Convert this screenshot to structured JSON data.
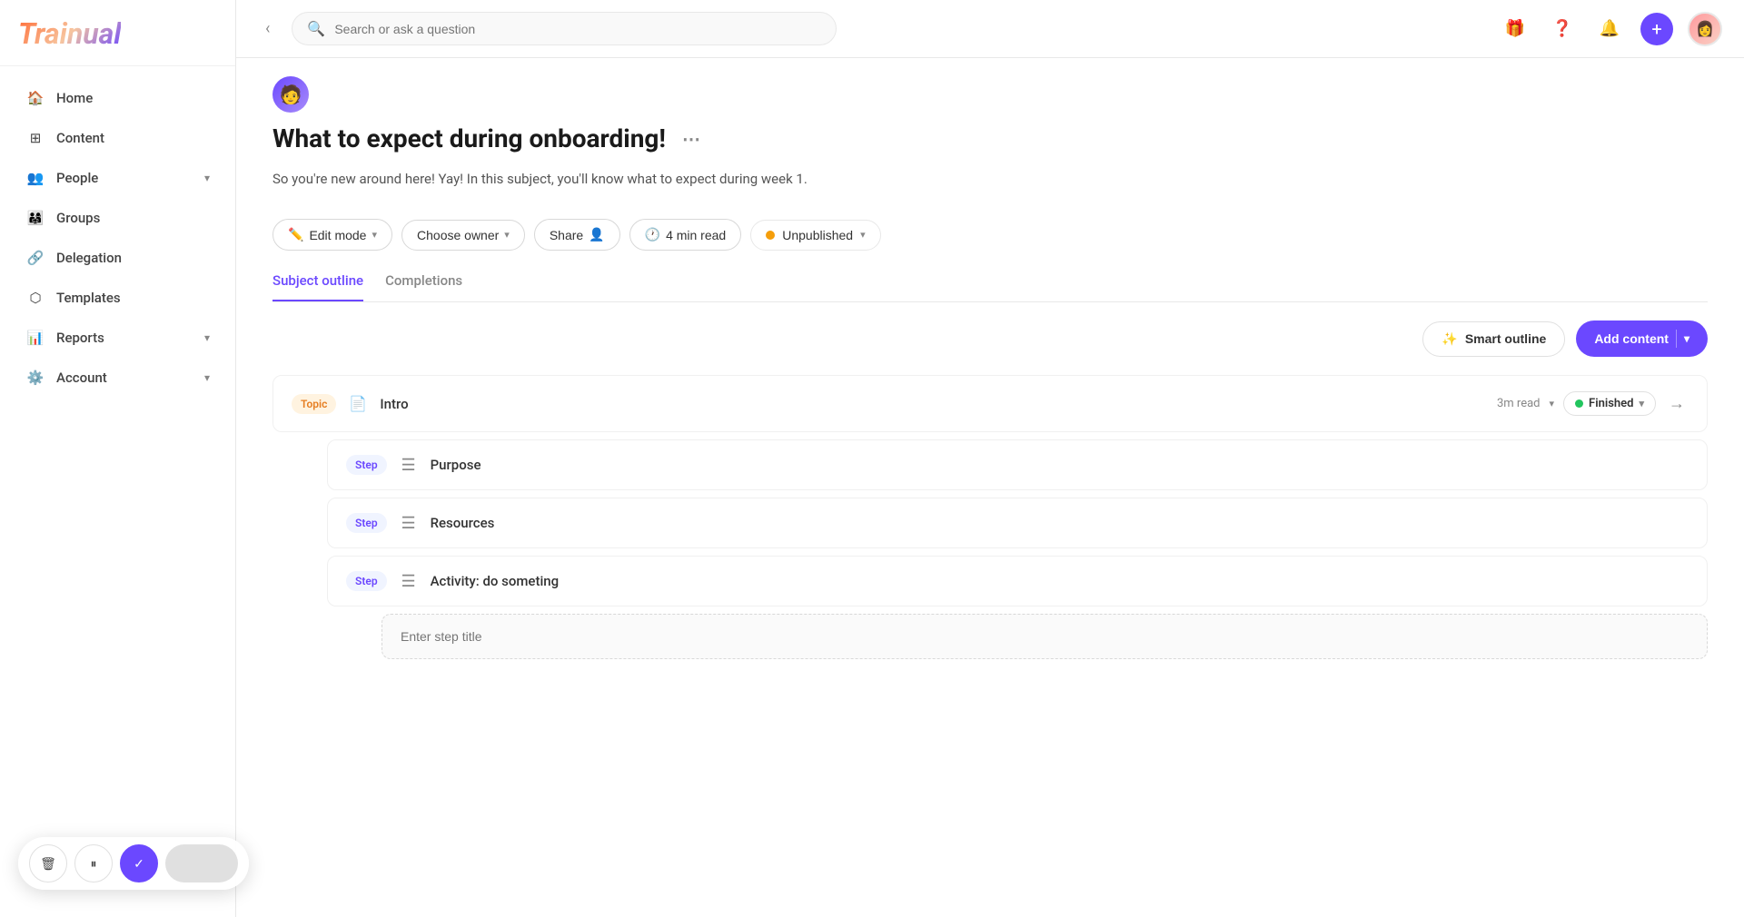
{
  "logo": {
    "text": "Trainual"
  },
  "sidebar": {
    "nav_items": [
      {
        "id": "home",
        "label": "Home",
        "icon": "🏠",
        "has_chevron": false
      },
      {
        "id": "content",
        "label": "Content",
        "icon": "⊞",
        "has_chevron": false
      },
      {
        "id": "people",
        "label": "People",
        "icon": "👥",
        "has_chevron": true
      },
      {
        "id": "groups",
        "label": "Groups",
        "icon": "👨‍👩‍👧",
        "has_chevron": false
      },
      {
        "id": "delegation",
        "label": "Delegation",
        "icon": "🔗",
        "has_chevron": false
      },
      {
        "id": "templates",
        "label": "Templates",
        "icon": "⬡",
        "has_chevron": false
      },
      {
        "id": "reports",
        "label": "Reports",
        "icon": "📊",
        "has_chevron": true
      },
      {
        "id": "account",
        "label": "Account",
        "icon": "⚙️",
        "has_chevron": true
      }
    ]
  },
  "topbar": {
    "search_placeholder": "Search or ask a question",
    "collapse_label": "‹"
  },
  "page": {
    "title": "What to expect during onboarding!",
    "description": "So you're new around here! Yay! In this subject, you'll know what to expect during week 1.",
    "read_time": "4 min read"
  },
  "toolbar": {
    "edit_mode_label": "Edit mode",
    "choose_owner_label": "Choose owner",
    "share_label": "Share",
    "status_label": "Unpublished"
  },
  "tabs": [
    {
      "id": "subject_outline",
      "label": "Subject outline",
      "active": true
    },
    {
      "id": "completions",
      "label": "Completions",
      "active": false
    }
  ],
  "outline_actions": {
    "smart_outline_label": "Smart outline",
    "add_content_label": "Add content"
  },
  "outline_items": [
    {
      "type": "topic",
      "badge_label": "Topic",
      "icon": "📄",
      "title": "Intro",
      "read_time": "3m read",
      "status": "Finished",
      "has_arrow": true
    },
    {
      "type": "step",
      "badge_label": "Step",
      "icon": "≡",
      "title": "Purpose",
      "read_time": null,
      "status": null,
      "has_arrow": false
    },
    {
      "type": "step",
      "badge_label": "Step",
      "icon": "≡",
      "title": "Resources",
      "read_time": null,
      "status": null,
      "has_arrow": false
    },
    {
      "type": "step",
      "badge_label": "Step",
      "icon": "≡",
      "title": "Activity: do someting",
      "read_time": null,
      "status": null,
      "has_arrow": false
    }
  ],
  "step_input": {
    "placeholder": "Enter step title"
  },
  "playback": {
    "delete_icon": "🗑",
    "pause_icon": "⏸",
    "check_icon": "✓"
  }
}
